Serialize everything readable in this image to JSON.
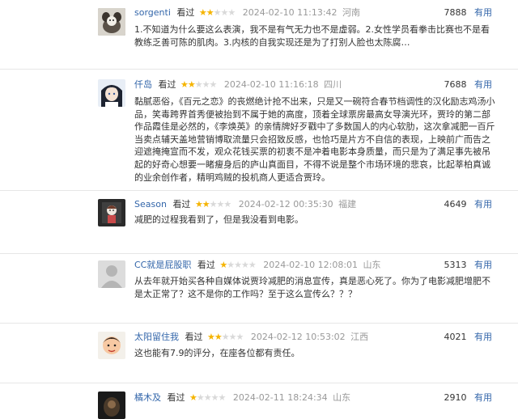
{
  "reviews": [
    {
      "user": "sorgenti",
      "watched": "看过",
      "stars": 2,
      "time": "2024-02-10 11:13:42",
      "place": "河南",
      "votes": "7888",
      "useful": "有用",
      "content": "1.不知道为什么要这么表演，我不是有气无力也不是虚弱。2.女性学员看拳击比赛也不是看教练乏善可陈的肌肉。3.内核的自我实现还是为了打别人脸也太陈腐…",
      "avatar": "photo"
    },
    {
      "user": "仟岛",
      "watched": "看过",
      "stars": 2,
      "time": "2024-02-10 11:16:18",
      "place": "四川",
      "votes": "7688",
      "useful": "有用",
      "content": "黏腻恶俗，《百元之恋》的丧燃绝计抢不出来，只是又一碗符合春节档调性的汉化励志鸡汤小品，笑毒跨界首秀便被抬到不属于她的高度，顶着全球票房最高女导演光环，贾玲的第二部作品霞佳是必然的，《李焕英》的亲情牌好歹戳中了多数国人的内心软肋，这次拿减肥一百斤当卖点辅天盖地营销博取流量只会招致反感，也恰巧是片方不自信的表现，上映前广而告之迎遮掩掩宣而不发，观众花钱买票的初衷不是冲着电影本身质量，而只是为了满足事先被吊起的好奇心想要一睹瘦身后的庐山真面目，不得不说是整个市场环境的悲哀，比起莘柏真诚的业余创作者，精明鸡贼的投机商人更适合贾玲。",
      "avatar": "anime"
    },
    {
      "user": "Season",
      "watched": "看过",
      "stars": 2,
      "time": "2024-02-12 00:35:30",
      "place": "福建",
      "votes": "4649",
      "useful": "有用",
      "content": "减肥的过程我看到了，但是我没看到电影。",
      "avatar": "doll"
    },
    {
      "user": "CC就是屁股职",
      "watched": "看过",
      "stars": 1,
      "time": "2024-02-10 12:08:01",
      "place": "山东",
      "votes": "5313",
      "useful": "有用",
      "content": "从去年就开始买各种自媒体说贾玲减肥的消息宣传，真是恶心死了。你为了电影减肥增肥不是太正常了？这不是你的工作吗？至于这么宣传么？？？",
      "avatar": "default"
    },
    {
      "user": "太阳留住我",
      "watched": "看过",
      "stars": 2,
      "time": "2024-02-12 10:53:02",
      "place": "江西",
      "votes": "4021",
      "useful": "有用",
      "content": "这也能有7.9的评分，在座各位都有责任。",
      "avatar": "cartoon"
    },
    {
      "user": "橘木及",
      "watched": "看过",
      "stars": 1,
      "time": "2024-02-11 18:24:34",
      "place": "山东",
      "votes": "2910",
      "useful": "有用",
      "content": "",
      "avatar": "dark"
    }
  ]
}
